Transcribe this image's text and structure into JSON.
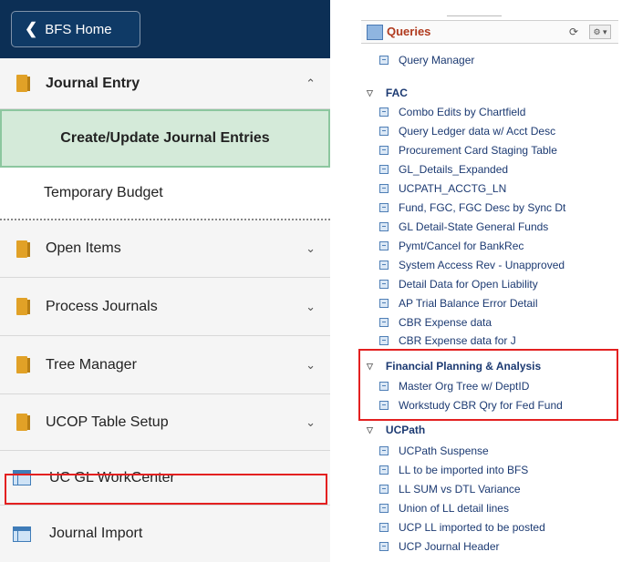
{
  "nav": {
    "home_label": "BFS Home",
    "items": [
      {
        "label": "Journal Entry"
      },
      {
        "label": "Create/Update Journal Entries"
      },
      {
        "label": "Temporary Budget"
      },
      {
        "label": "Open Items"
      },
      {
        "label": "Process Journals"
      },
      {
        "label": "Tree Manager"
      },
      {
        "label": "UCOP Table Setup"
      },
      {
        "label": "UC GL WorkCenter"
      },
      {
        "label": "Journal Import"
      }
    ]
  },
  "queries": {
    "title": "Queries",
    "top_items": [
      "Query Manager"
    ],
    "folders": [
      {
        "name": "FAC",
        "items": [
          "Combo Edits by Chartfield",
          "Query Ledger data w/ Acct Desc",
          "Procurement Card Staging Table",
          "GL_Details_Expanded",
          "UCPATH_ACCTG_LN",
          "Fund, FGC, FGC Desc by Sync Dt",
          "GL Detail-State General Funds",
          "Pymt/Cancel for BankRec",
          "System Access Rev - Unapproved",
          "Detail Data for Open Liability",
          "AP Trial Balance Error Detail",
          "CBR Expense data",
          "CBR Expense data for J"
        ]
      },
      {
        "name": "Financial Planning & Analysis",
        "items": [
          "Master Org Tree w/ DeptID",
          "Workstudy CBR Qry for Fed Fund"
        ]
      },
      {
        "name": "UCPath",
        "items": [
          "UCPath Suspense",
          "LL to be imported into BFS",
          "LL SUM vs DTL Variance",
          "Union of LL detail lines",
          "UCP LL imported to be posted",
          "UCP Journal Header"
        ]
      }
    ]
  },
  "icons": {
    "home_back": "chevron-left-icon",
    "folder": "folder-icon",
    "workcenter": "window-icon",
    "query": "query-doc-icon",
    "expand": "triangle-down-icon",
    "collapse_caret": "chevron-up-icon",
    "expand_caret": "chevron-down-icon",
    "refresh": "refresh-icon",
    "settings": "gear-icon"
  },
  "colors": {
    "header_bg": "#0c2f55",
    "selected_bg": "#d4ead9",
    "highlight_box": "#e32020",
    "folder": "#e1a127",
    "link": "#1c3a72",
    "query_title": "#b03a1e"
  }
}
